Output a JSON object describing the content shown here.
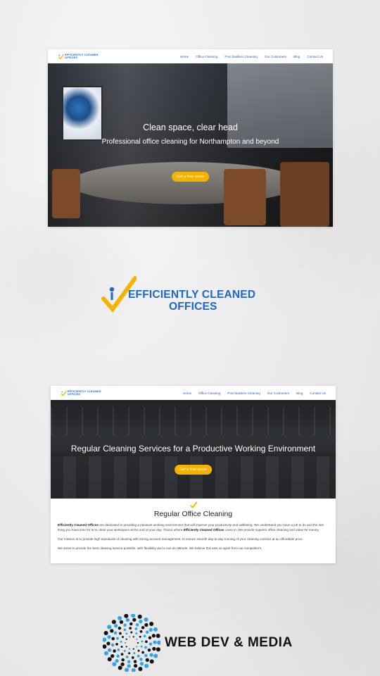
{
  "brand": {
    "name_line1": "EFFICIENTLY CLEANED",
    "name_line2": "OFFICES",
    "accent_blue": "#1e66d0",
    "accent_yellow": "#f5b301"
  },
  "nav": {
    "items": [
      "Home",
      "Office Cleaning",
      "Post Builders Cleaning",
      "Our Customers",
      "Blog",
      "Contact Us"
    ]
  },
  "mockup1": {
    "headline": "Clean space, clear head",
    "subheadline": "Professional office cleaning for Northampton and beyond",
    "cta": "Get a free quote"
  },
  "mockup2": {
    "headline": "Regular Cleaning Services for a Productive Working Environment",
    "cta": "Get a free quote",
    "section_title": "Regular Office Cleaning",
    "para1_strong": "Efficiently Cleaned Offices",
    "para1_a": " are dedicated to providing a pleasant working environment that will improve your productivity and wellbeing. We understand you have a job to do and the last thing you have time for is to clean your workspace at the end of your day. That is where ",
    "para1_strong2": "Efficiently Cleaned Offices",
    "para1_b": " come in. We provide superior office cleaning and value for money.",
    "para2": "Our mission is to provide high standards of cleaning with strong account management, to ensure smooth day-to-day running of your cleaning contract at an affordable price.",
    "para3": "We strive to provide the best cleaning service possible, with flexibility and a can-do attitude. We believe this sets us apart from our competitors."
  },
  "agency": {
    "name": "WEB DEV & MEDIA",
    "icon": "spiral-dots-icon",
    "colors": [
      "#111111",
      "#2fa4e7"
    ]
  }
}
